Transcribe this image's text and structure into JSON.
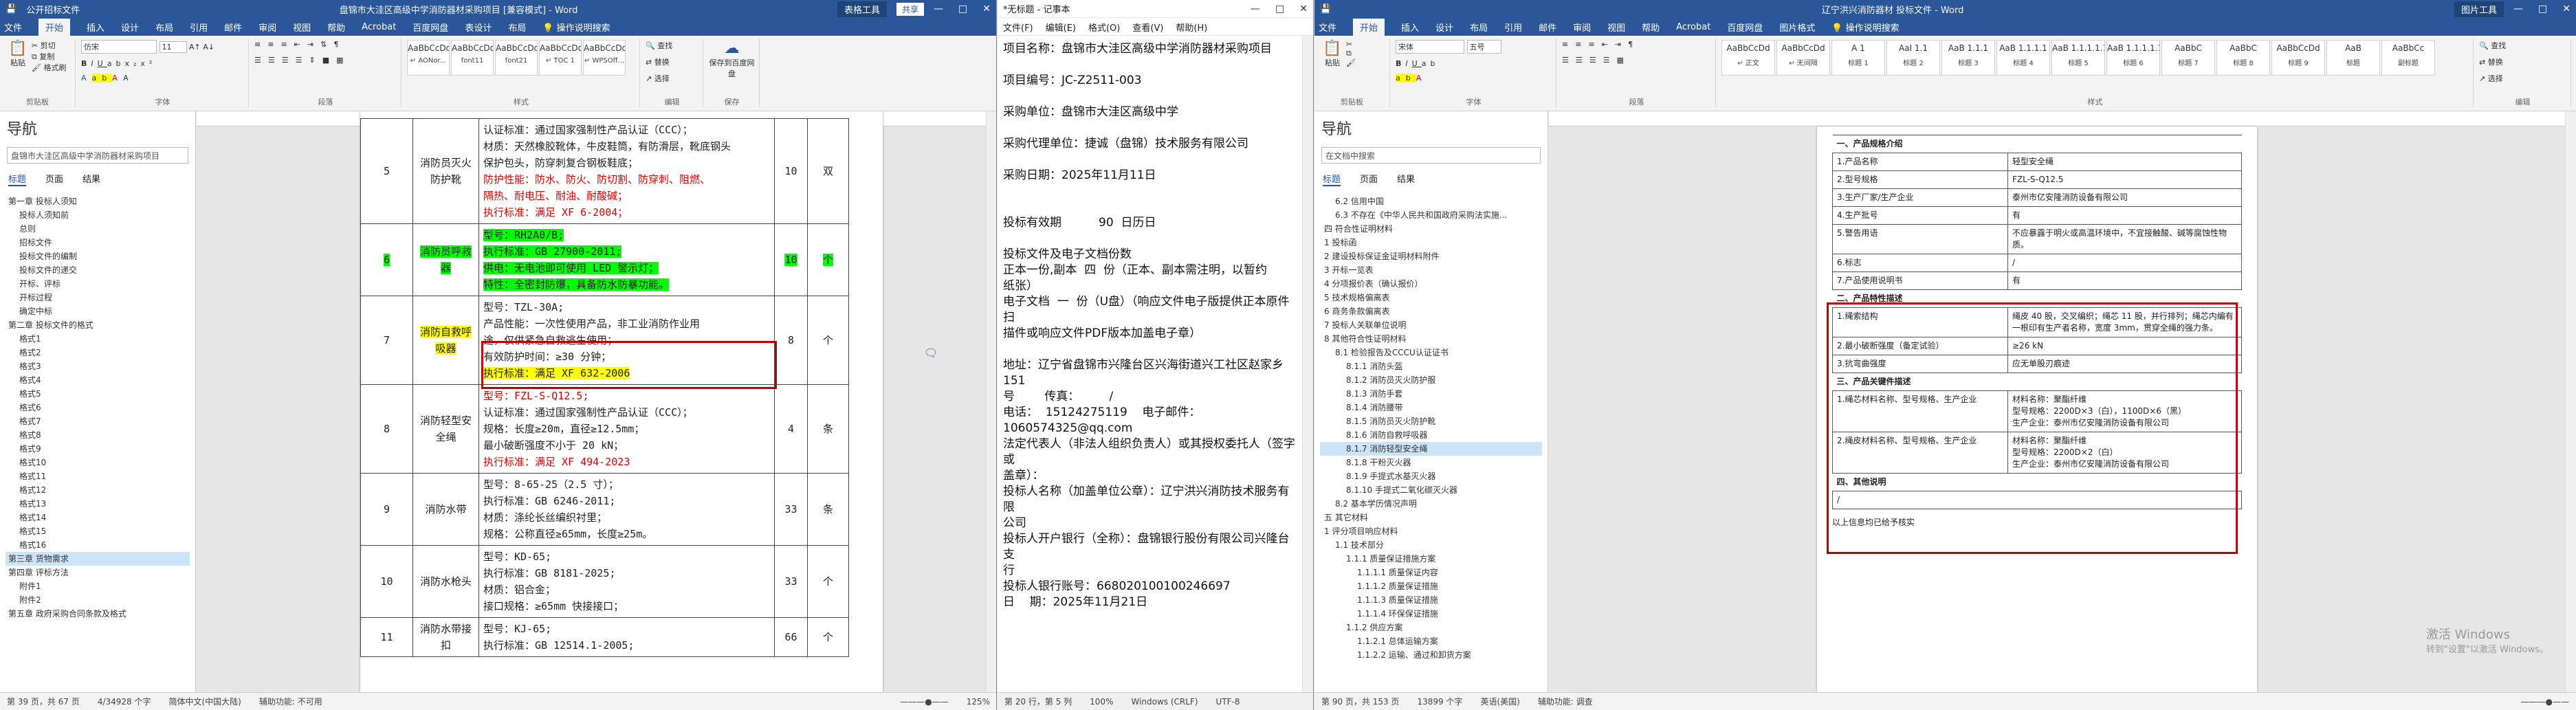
{
  "left": {
    "title_left": "公开招标文件",
    "title": "盘锦市大洼区高级中学消防器材采购项目 [兼容模式] - Word",
    "context_tab": "表格工具",
    "share": "共享",
    "menu": [
      "文件",
      "开始",
      "插入",
      "设计",
      "布局",
      "引用",
      "邮件",
      "审阅",
      "视图",
      "帮助",
      "Acrobat",
      "百度网盘",
      "表设计",
      "布局",
      "操作说明搜索"
    ],
    "ribbon": {
      "clipboard": "剪贴板",
      "font": "字体",
      "paragraph": "段落",
      "styles": "样式",
      "editing": "编辑",
      "save": "保存",
      "font_name": "仿宋",
      "font_size": "11",
      "paste": "粘贴",
      "cut": "剪切",
      "copy": "复制",
      "format": "格式刷",
      "find": "查找",
      "replace": "替换",
      "select": "选择",
      "baidu": "保存到百度网盘",
      "style_items": [
        {
          "s": "AaBbCcDd",
          "n": "↵ AONor..."
        },
        {
          "s": "AaBbCcDd",
          "n": "font11"
        },
        {
          "s": "AaBbCcDd",
          "n": "font21"
        },
        {
          "s": "AaBbCcDd",
          "n": "↵ TOC 1"
        },
        {
          "s": "AaBbCcDd",
          "n": "↵ WPSOff..."
        }
      ]
    },
    "nav": {
      "title": "导航",
      "search": "盘锦市大洼区高级中学消防器材采购项目",
      "tabs": [
        "标题",
        "页面",
        "结果"
      ],
      "items": [
        "第一章 投标人须知",
        "投标人须知前",
        "总则",
        "招标文件",
        "投标文件的编制",
        "投标文件的递交",
        "开标、评标",
        "开标过程",
        "确定中标",
        "第二章 投标文件的格式",
        "格式1",
        "格式2",
        "格式3",
        "格式4",
        "格式5",
        "格式6",
        "格式7",
        "格式8",
        "格式9",
        "格式10",
        "格式11",
        "格式12",
        "格式13",
        "格式14",
        "格式15",
        "格式16",
        "第三章 货物需求",
        "第四章 评标方法",
        "附件1",
        "附件2",
        "第五章 政府采购合同条款及格式"
      ],
      "selected": 26
    },
    "rows": [
      {
        "n": "5",
        "name": "消防员灭火防护靴",
        "spec": [
          [
            "认证标准：通过国家强制性产品认证（CCC）；",
            ""
          ],
          [
            "材质：天然橡胶靴体，牛皮鞋筒，有防滑层，靴底钢头",
            ""
          ],
          [
            "保护包头，防穿刺复合钢板鞋底；",
            ""
          ],
          [
            "防护性能：防水、防火、防切割、防穿刺、阻燃、",
            "red"
          ],
          [
            "隔热、耐电压、耐油、耐酸碱；",
            "red"
          ],
          [
            "执行标准：满足 XF 6-2004；",
            "red"
          ]
        ],
        "qty": "10",
        "unit": "双"
      },
      {
        "n": "6",
        "name": "消防员呼救器",
        "spec": [
          [
            "型号：RH2A0/B;",
            "hg"
          ],
          [
            "执行标准：GB 27900-2011;",
            "hg"
          ],
          [
            "供电：无电池即可使用 LED 警示灯；",
            "hg"
          ],
          [
            "特性：全密封防爆，具备防水防暴功能。",
            "hg"
          ]
        ],
        "qty": "10",
        "unit": "个",
        "hl": true
      },
      {
        "n": "7",
        "name": "消防自救呼吸器",
        "spec": [
          [
            "型号：TZL-30A;",
            ""
          ],
          [
            "产品性能：一次性使用产品，非工业消防作业用",
            ""
          ],
          [
            "途，仅供紧急自救逃生使用；",
            ""
          ],
          [
            "有效防护时间：≥30 分钟；",
            ""
          ],
          [
            "执行标准：满足 XF 632-2006",
            "hl"
          ]
        ],
        "qty": "8",
        "unit": "个"
      },
      {
        "n": "8",
        "name": "消防轻型安全绳",
        "spec": [
          [
            "型号：FZL-S-Q12.5;",
            "red"
          ],
          [
            "认证标准：通过国家强制性产品认证（CCC）；",
            ""
          ],
          [
            "规格：长度≥20m，直径≥12.5mm；",
            ""
          ],
          [
            "最小破断强度不小于 20 kN；",
            ""
          ],
          [
            "执行标准：满足 XF 494-2023",
            "red"
          ]
        ],
        "qty": "4",
        "unit": "条"
      },
      {
        "n": "9",
        "name": "消防水带",
        "spec": [
          [
            "型号：8-65-25（2.5 寸）；",
            ""
          ],
          [
            "执行标准：GB 6246-2011;",
            ""
          ],
          [
            "材质：涤纶长丝编织衬里；",
            ""
          ],
          [
            "规格：公称直径≥65mm，长度≥25m。",
            ""
          ]
        ],
        "qty": "33",
        "unit": "条"
      },
      {
        "n": "10",
        "name": "消防水枪头",
        "spec": [
          [
            "型号：KD-65;",
            ""
          ],
          [
            "执行标准：GB 8181-2025;",
            ""
          ],
          [
            "材质：铝合金；",
            ""
          ],
          [
            "接口规格：≥65mm 快接接口；",
            ""
          ]
        ],
        "qty": "33",
        "unit": "个"
      },
      {
        "n": "11",
        "name": "消防水带接扣",
        "spec": [
          [
            "型号：KJ-65;",
            ""
          ],
          [
            "执行标准：GB 12514.1-2005;",
            ""
          ]
        ],
        "qty": "66",
        "unit": "个"
      }
    ],
    "status": [
      "第 39 页，共 67 页",
      "4/34928 个字",
      "简体中文(中国大陆)",
      "辅助功能: 不可用",
      "125%"
    ]
  },
  "middle": {
    "title": "*无标题 - 记事本",
    "menu": [
      "文件(F)",
      "编辑(E)",
      "格式(O)",
      "查看(V)",
      "帮助(H)"
    ],
    "text": "项目名称：盘锦市大洼区高级中学消防器材采购项目\n\n项目编号：JC-Z2511-003\n\n采购单位：盘锦市大洼区高级中学\n\n采购代理单位：捷诚（盘锦）技术服务有限公司\n\n采购日期：2025年11月11日\n\n\n投标有效期          90  日历日\n\n投标文件及电子文档份数\n正本一份,副本  四  份（正本、副本需注明，以暂约\n纸张）\n电子文档  一  份（U盘）（响应文件电子版提供正本原件扫\n描件或响应文件PDF版本加盖电子章）\n\n地址：辽宁省盘锦市兴隆台区兴海街道兴工社区赵家乡151\n号        传真：        /\n电话：  15124275119    电子邮件：1060574325@qq.com\n法定代表人（非法人组织负责人）或其授权委托人（签字或\n盖章）：\n投标人名称（加盖单位公章）：辽宁洪兴消防技术服务有限\n公司\n投标人开户银行（全称）：盘锦银行股份有限公司兴隆台支\n行\n投标人银行账号：668020100100246697\n日    期：2025年11月21日",
    "status": [
      "第 20 行，第 5 列",
      "100%",
      "Windows (CRLF)",
      "UTF-8"
    ]
  },
  "right": {
    "title": "辽宁洪兴消防器材 投标文件 - Word",
    "context_tab": "图片工具",
    "menu": [
      "文件",
      "开始",
      "插入",
      "设计",
      "布局",
      "引用",
      "邮件",
      "审阅",
      "视图",
      "帮助",
      "Acrobat",
      "百度网盘",
      "图片格式",
      "操作说明搜索"
    ],
    "font_name": "宋体",
    "font_size": "五号",
    "style_items": [
      {
        "s": "AaBbCcDd",
        "n": "↵ 正文"
      },
      {
        "s": "AaBbCcDd",
        "n": "↵ 无间隔"
      },
      {
        "s": "A 1",
        "n": "标题 1"
      },
      {
        "s": "AaI 1.1",
        "n": "标题 2"
      },
      {
        "s": "AaB 1.1.1",
        "n": "标题 3"
      },
      {
        "s": "AaB 1.1.1.1",
        "n": "标题 4"
      },
      {
        "s": "AaB 1.1.1.1.1",
        "n": "标题 5"
      },
      {
        "s": "AaB 1.1.1.1.1.1",
        "n": "标题 6"
      },
      {
        "s": "AaBbC",
        "n": "标题 7"
      },
      {
        "s": "AaBbC",
        "n": "标题 8"
      },
      {
        "s": "AaBbCcDd",
        "n": "标题 9"
      },
      {
        "s": "AaB",
        "n": "标题"
      },
      {
        "s": "AaBbCc",
        "n": "副标题"
      }
    ],
    "nav": {
      "title": "导航",
      "search": "在文档中搜索",
      "tabs": [
        "标题",
        "页面",
        "结果"
      ],
      "items": [
        "6.2 信用中国",
        "6.3 不存在《中华人民共和国政府采购法实施...",
        "四 符合性证明材料",
        "1 投标函",
        "2 建设投标保证金证明材料附件",
        "3 开标一览表",
        "4 分项报价表（确认报价）",
        "5 技术规格偏离表",
        "6 商务条款偏离表",
        "7 投标人关联单位说明",
        "8 其他符合性证明材料",
        "8.1 检验报告及CCCU认证证书",
        "8.1.1 消防头盔",
        "8.1.2 消防员灭火防护服",
        "8.1.3 消防手套",
        "8.1.4 消防腰带",
        "8.1.5 消防员灭火防护靴",
        "8.1.6 消防自救呼吸器",
        "8.1.7 消防轻型安全绳",
        "8.1.8 干粉灭火器",
        "8.1.9 手提式水基灭火器",
        "8.1.10 手提式二氧化碳灭火器",
        "8.2 基本学历情况声明",
        "五 其它材料",
        "1 评分项目响应材料",
        "1.1 技术部分",
        "1.1.1 质量保证措施方案",
        "1.1.1.1 质量保证内容",
        "1.1.1.2 质量保证措施",
        "1.1.1.3 质量保证措施",
        "1.1.1.4 环保保证措施",
        "1.1.2 供应方案",
        "1.1.2.1 总体运输方案",
        "1.1.2.2 运输、通过和卸货方案"
      ],
      "selected": 18
    },
    "doc": {
      "sec1": "一、产品规格介绍",
      "rows1": [
        [
          "1.产品名称",
          "轻型安全绳"
        ],
        [
          "2.型号规格",
          "FZL-S-Q12.5"
        ],
        [
          "3.生产厂家/生产企业",
          "泰州市亿安隆消防设备有限公司"
        ],
        [
          "4.生产批号",
          "有"
        ],
        [
          "5.警告用语",
          "不应暴露于明火或高温环境中，不宜接触酸、碱等腐蚀性物质。"
        ],
        [
          "6.标志",
          "/"
        ],
        [
          "7.产品使用说明书",
          "有"
        ]
      ],
      "sec2": "二、产品特性描述",
      "rows2": [
        [
          "1.绳索结构",
          "绳皮 40 股，交叉编织；绳芯 11 股，并行排列；绳芯内编有一根印有生产者名称，宽度 3mm，贯穿全绳的强力条。"
        ],
        [
          "2.最小破断强度（备定试验）",
          "≥26 kN"
        ],
        [
          "3.抗弯曲强度",
          "应无单股刃痕迹"
        ]
      ],
      "sec3": "三、产品关键件描述",
      "rows3": [
        [
          "1.绳芯材料名称、型号规格、生产企业",
          "材料名称：聚酯纤维\n型号规格：2200D×3（白），1100D×6（黑）\n生产企业：泰州市亿安隆消防设备有限公司"
        ],
        [
          "2.绳皮材料名称、型号规格、生产企业",
          "材料名称：聚酯纤维\n型号规格：2200D×2（白）\n生产企业：泰州市亿安隆消防设备有限公司"
        ]
      ],
      "sec4": "四、其他说明",
      "other": "/",
      "tail": "以上信息均已给予核实"
    },
    "status": [
      "第 90 页，共 153 页",
      "13899 个字",
      "英语(美国)",
      "辅助功能: 调查"
    ],
    "activate1": "激活 Windows",
    "activate2": "转到\"设置\"以激活 Windows。"
  },
  "colors": {
    "word_blue": "#2b579a",
    "highlight_yellow": "#ffff00",
    "highlight_green": "#00ff00",
    "red_box": "#c00000"
  }
}
